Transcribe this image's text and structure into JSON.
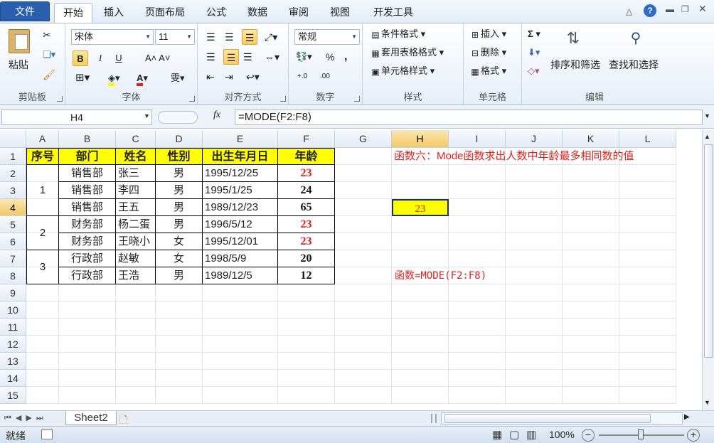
{
  "tabs": {
    "file": "文件",
    "home": "开始",
    "insert": "插入",
    "layout": "页面布局",
    "formula": "公式",
    "data": "数据",
    "review": "审阅",
    "view": "视图",
    "dev": "开发工具"
  },
  "ribbon": {
    "clipboard": {
      "label": "剪贴板",
      "paste": "粘贴"
    },
    "font": {
      "label": "字体",
      "name": "宋体",
      "size": "11",
      "bold": "B",
      "italic": "I",
      "underline": "U"
    },
    "align": {
      "label": "对齐方式"
    },
    "number": {
      "label": "数字",
      "format": "常规",
      "percent": "%",
      "comma": ","
    },
    "styles": {
      "label": "样式",
      "cond": "条件格式",
      "table": "套用表格格式",
      "cell": "单元格样式"
    },
    "cells": {
      "label": "单元格",
      "insert": "插入",
      "delete": "删除",
      "format": "格式"
    },
    "editing": {
      "label": "编辑",
      "sort": "排序和筛选",
      "find": "查找和选择",
      "sigma": "Σ"
    }
  },
  "formula_bar": {
    "name_box": "H4",
    "fx": "fx",
    "formula": "=MODE(F2:F8)"
  },
  "columns": [
    "A",
    "B",
    "C",
    "D",
    "E",
    "F",
    "G",
    "H",
    "I",
    "J",
    "K",
    "L"
  ],
  "rows": [
    "1",
    "2",
    "3",
    "4",
    "5",
    "6",
    "7",
    "8",
    "9",
    "10",
    "11",
    "12",
    "13",
    "14",
    "15"
  ],
  "headers": {
    "a": "序号",
    "b": "部门",
    "c": "姓名",
    "d": "性别",
    "e": "出生年月日",
    "f": "年龄"
  },
  "records": [
    {
      "dept": "销售部",
      "name": "张三",
      "sex": "男",
      "birth": "1995/12/25",
      "age": "23"
    },
    {
      "dept": "销售部",
      "name": "李四",
      "sex": "男",
      "birth": "1995/1/25",
      "age": "24"
    },
    {
      "dept": "销售部",
      "name": "王五",
      "sex": "男",
      "birth": "1989/12/23",
      "age": "65"
    },
    {
      "dept": "财务部",
      "name": "杨二蛋",
      "sex": "男",
      "birth": "1996/5/12",
      "age": "23"
    },
    {
      "dept": "财务部",
      "name": "王晓小",
      "sex": "女",
      "birth": "1995/12/01",
      "age": "23"
    },
    {
      "dept": "行政部",
      "name": "赵敏",
      "sex": "女",
      "birth": "1998/5/9",
      "age": "20"
    },
    {
      "dept": "行政部",
      "name": "王浩",
      "sex": "男",
      "birth": "1989/12/5",
      "age": "12"
    }
  ],
  "groups": [
    "1",
    "2",
    "3"
  ],
  "note_title": "函数六：Mode函数求出人数中年龄最多相同数的值",
  "note_formula": "函数=MODE(F2:F8)",
  "result": "23",
  "sheet_tab": "Sheet2",
  "status": {
    "ready": "就绪",
    "zoom": "100%"
  },
  "colors": {
    "accent": "#2a5fad",
    "header_fill": "#ffff00",
    "note_red": "#e0201c"
  }
}
